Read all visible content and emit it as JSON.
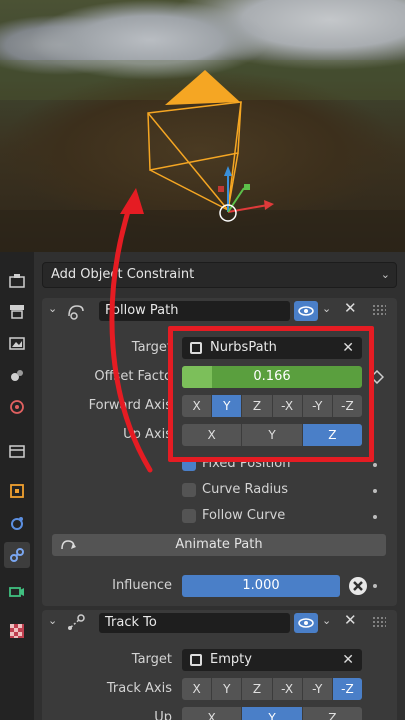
{
  "add_constraint": {
    "label": "Add Object Constraint"
  },
  "follow_path": {
    "name": "Follow Path",
    "target_label": "Target",
    "target_value": "NurbsPath",
    "offset_label": "Offset Facto",
    "offset_value": "0.166",
    "offset_fraction": 0.166,
    "forward_label": "Forward Axis",
    "forward_options": [
      "X",
      "Y",
      "Z",
      "-X",
      "-Y",
      "-Z"
    ],
    "forward_selected": "Y",
    "up_label": "Up Axis",
    "up_options": [
      "X",
      "Y",
      "Z"
    ],
    "up_selected": "Z",
    "fixed_position": "Fixed Position",
    "curve_radius": "Curve Radius",
    "follow_curve": "Follow Curve",
    "animate_path": "Animate Path",
    "influence_label": "Influence",
    "influence_value": "1.000"
  },
  "track_to": {
    "name": "Track To",
    "target_label": "Target",
    "target_value": "Empty",
    "track_axis_label": "Track Axis",
    "track_options": [
      "X",
      "Y",
      "Z",
      "-X",
      "-Y",
      "-Z"
    ],
    "track_selected": "-Z",
    "up_label": "Up",
    "up_options": [
      "X",
      "Y",
      "Z"
    ],
    "up_selected": "Y"
  },
  "colors": {
    "accent": "#4a7fc8",
    "highlight_box": "#e51c23",
    "slider_green": "#5a9f3e"
  },
  "tabs": [
    "tool-icon",
    "render-icon",
    "output-icon",
    "view-layer-icon",
    "scene-icon",
    "collection-icon",
    "object-icon",
    "modifier-icon",
    "constraint-icon",
    "data-icon",
    "texture-icon"
  ]
}
